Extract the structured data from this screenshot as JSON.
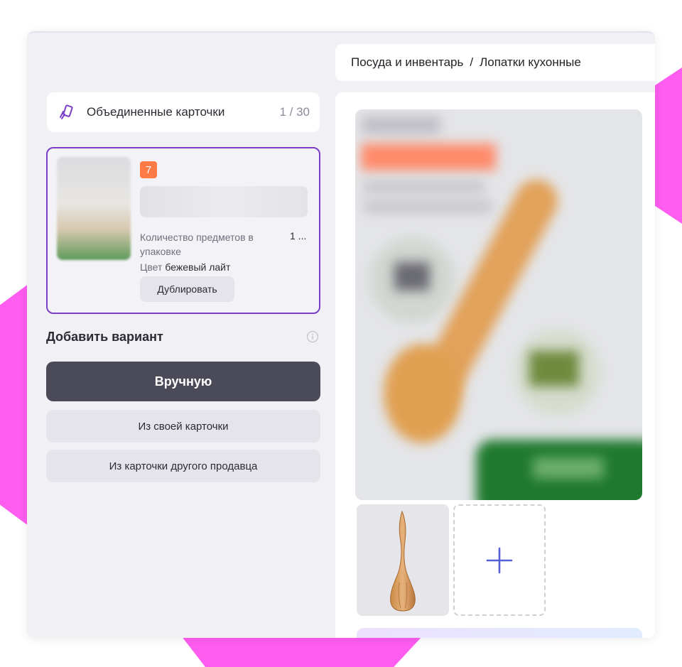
{
  "breadcrumb": {
    "parent": "Посуда и инвентарь",
    "separator": "/",
    "current": "Лопатки кухонные"
  },
  "merged_cards": {
    "label": "Объединенные карточки",
    "counter": "1 / 30"
  },
  "product_card": {
    "badge": "7",
    "property_label": "Количество предметов в упаковке",
    "property_value": "1 ...",
    "color_label": "Цвет",
    "color_value": "бежевый лайт",
    "duplicate_label": "Дублировать"
  },
  "add_variant": {
    "title": "Добавить вариант",
    "manual_label": "Вручную",
    "own_card_label": "Из своей карточки",
    "other_seller_label": "Из карточки другого продавца"
  },
  "colors": {
    "accent_purple": "#7a3ec7",
    "badge_orange": "#ff7a45",
    "primary_button": "#4b4a58",
    "add_photo_plus": "#5560d6",
    "decor_pink": "#ff5cf0"
  },
  "icons": {
    "merged": "merged-cards-icon",
    "info": "info-icon",
    "add_photo": "plus-icon"
  }
}
